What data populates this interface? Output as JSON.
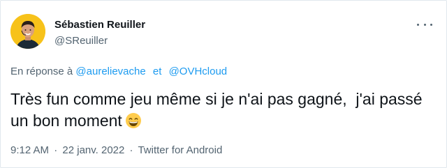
{
  "author": {
    "name": "Sébastien Reuiller",
    "handle": "@SReuiller"
  },
  "reply": {
    "prefix": "En réponse à",
    "mentions": [
      "@aurelievache",
      "@OVHcloud"
    ],
    "separator": "et"
  },
  "tweet": {
    "text": "Très fun comme jeu même si je n'ai pas gagné,  j'ai passé un bon moment",
    "emoji": "grinning-face-with-smiling-eyes"
  },
  "meta": {
    "time": "9:12 AM",
    "date": "22 janv. 2022",
    "source": "Twitter for Android",
    "dot": "·"
  },
  "colors": {
    "link": "#1d9bf0",
    "secondary_text": "#536471",
    "primary_text": "#0f1419",
    "avatar_bg": "#f7c21a"
  }
}
